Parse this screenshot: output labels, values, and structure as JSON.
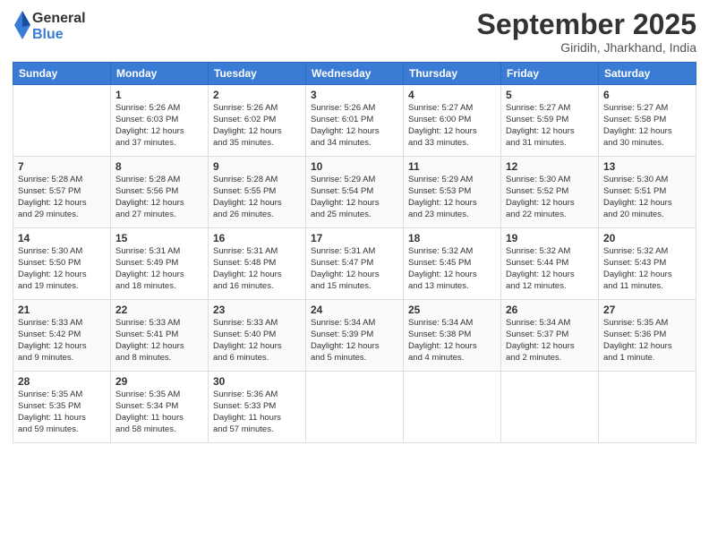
{
  "logo": {
    "general": "General",
    "blue": "Blue"
  },
  "header": {
    "month": "September 2025",
    "location": "Giridih, Jharkhand, India"
  },
  "weekdays": [
    "Sunday",
    "Monday",
    "Tuesday",
    "Wednesday",
    "Thursday",
    "Friday",
    "Saturday"
  ],
  "weeks": [
    [
      {
        "day": "",
        "info": ""
      },
      {
        "day": "1",
        "info": "Sunrise: 5:26 AM\nSunset: 6:03 PM\nDaylight: 12 hours\nand 37 minutes."
      },
      {
        "day": "2",
        "info": "Sunrise: 5:26 AM\nSunset: 6:02 PM\nDaylight: 12 hours\nand 35 minutes."
      },
      {
        "day": "3",
        "info": "Sunrise: 5:26 AM\nSunset: 6:01 PM\nDaylight: 12 hours\nand 34 minutes."
      },
      {
        "day": "4",
        "info": "Sunrise: 5:27 AM\nSunset: 6:00 PM\nDaylight: 12 hours\nand 33 minutes."
      },
      {
        "day": "5",
        "info": "Sunrise: 5:27 AM\nSunset: 5:59 PM\nDaylight: 12 hours\nand 31 minutes."
      },
      {
        "day": "6",
        "info": "Sunrise: 5:27 AM\nSunset: 5:58 PM\nDaylight: 12 hours\nand 30 minutes."
      }
    ],
    [
      {
        "day": "7",
        "info": "Sunrise: 5:28 AM\nSunset: 5:57 PM\nDaylight: 12 hours\nand 29 minutes."
      },
      {
        "day": "8",
        "info": "Sunrise: 5:28 AM\nSunset: 5:56 PM\nDaylight: 12 hours\nand 27 minutes."
      },
      {
        "day": "9",
        "info": "Sunrise: 5:28 AM\nSunset: 5:55 PM\nDaylight: 12 hours\nand 26 minutes."
      },
      {
        "day": "10",
        "info": "Sunrise: 5:29 AM\nSunset: 5:54 PM\nDaylight: 12 hours\nand 25 minutes."
      },
      {
        "day": "11",
        "info": "Sunrise: 5:29 AM\nSunset: 5:53 PM\nDaylight: 12 hours\nand 23 minutes."
      },
      {
        "day": "12",
        "info": "Sunrise: 5:30 AM\nSunset: 5:52 PM\nDaylight: 12 hours\nand 22 minutes."
      },
      {
        "day": "13",
        "info": "Sunrise: 5:30 AM\nSunset: 5:51 PM\nDaylight: 12 hours\nand 20 minutes."
      }
    ],
    [
      {
        "day": "14",
        "info": "Sunrise: 5:30 AM\nSunset: 5:50 PM\nDaylight: 12 hours\nand 19 minutes."
      },
      {
        "day": "15",
        "info": "Sunrise: 5:31 AM\nSunset: 5:49 PM\nDaylight: 12 hours\nand 18 minutes."
      },
      {
        "day": "16",
        "info": "Sunrise: 5:31 AM\nSunset: 5:48 PM\nDaylight: 12 hours\nand 16 minutes."
      },
      {
        "day": "17",
        "info": "Sunrise: 5:31 AM\nSunset: 5:47 PM\nDaylight: 12 hours\nand 15 minutes."
      },
      {
        "day": "18",
        "info": "Sunrise: 5:32 AM\nSunset: 5:45 PM\nDaylight: 12 hours\nand 13 minutes."
      },
      {
        "day": "19",
        "info": "Sunrise: 5:32 AM\nSunset: 5:44 PM\nDaylight: 12 hours\nand 12 minutes."
      },
      {
        "day": "20",
        "info": "Sunrise: 5:32 AM\nSunset: 5:43 PM\nDaylight: 12 hours\nand 11 minutes."
      }
    ],
    [
      {
        "day": "21",
        "info": "Sunrise: 5:33 AM\nSunset: 5:42 PM\nDaylight: 12 hours\nand 9 minutes."
      },
      {
        "day": "22",
        "info": "Sunrise: 5:33 AM\nSunset: 5:41 PM\nDaylight: 12 hours\nand 8 minutes."
      },
      {
        "day": "23",
        "info": "Sunrise: 5:33 AM\nSunset: 5:40 PM\nDaylight: 12 hours\nand 6 minutes."
      },
      {
        "day": "24",
        "info": "Sunrise: 5:34 AM\nSunset: 5:39 PM\nDaylight: 12 hours\nand 5 minutes."
      },
      {
        "day": "25",
        "info": "Sunrise: 5:34 AM\nSunset: 5:38 PM\nDaylight: 12 hours\nand 4 minutes."
      },
      {
        "day": "26",
        "info": "Sunrise: 5:34 AM\nSunset: 5:37 PM\nDaylight: 12 hours\nand 2 minutes."
      },
      {
        "day": "27",
        "info": "Sunrise: 5:35 AM\nSunset: 5:36 PM\nDaylight: 12 hours\nand 1 minute."
      }
    ],
    [
      {
        "day": "28",
        "info": "Sunrise: 5:35 AM\nSunset: 5:35 PM\nDaylight: 11 hours\nand 59 minutes."
      },
      {
        "day": "29",
        "info": "Sunrise: 5:35 AM\nSunset: 5:34 PM\nDaylight: 11 hours\nand 58 minutes."
      },
      {
        "day": "30",
        "info": "Sunrise: 5:36 AM\nSunset: 5:33 PM\nDaylight: 11 hours\nand 57 minutes."
      },
      {
        "day": "",
        "info": ""
      },
      {
        "day": "",
        "info": ""
      },
      {
        "day": "",
        "info": ""
      },
      {
        "day": "",
        "info": ""
      }
    ]
  ]
}
